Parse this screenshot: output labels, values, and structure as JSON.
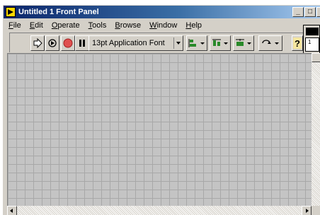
{
  "window": {
    "title": "Untitled 1 Front Panel",
    "controls": {
      "minimize": "_",
      "maximize": "□",
      "close": "×"
    }
  },
  "menubar": {
    "items": [
      {
        "mnemonic": "F",
        "rest": "ile"
      },
      {
        "mnemonic": "E",
        "rest": "dit"
      },
      {
        "mnemonic": "O",
        "rest": "perate"
      },
      {
        "mnemonic": "T",
        "rest": "ools"
      },
      {
        "mnemonic": "B",
        "rest": "rowse"
      },
      {
        "mnemonic": "W",
        "rest": "indow"
      },
      {
        "mnemonic": "H",
        "rest": "elp"
      }
    ]
  },
  "toolbar": {
    "buttons": [
      "run-arrow-icon",
      "run-continuously-icon",
      "abort-execution-icon",
      "pause-icon"
    ],
    "font_select": {
      "value": "13pt Application Font"
    },
    "dropdowns": [
      "align-objects-icon",
      "distribute-objects-icon",
      "resize-objects-icon",
      "reorder-icon"
    ],
    "help": "context-help-icon"
  },
  "connector": {
    "number": "1"
  },
  "colors": {
    "title_active": "#0a246a",
    "title_gradient_end": "#a6caf0",
    "panel_bg": "#c4c4c4",
    "grid_line": "#a8a8a8",
    "chrome": "#d4d0c8",
    "abort_red": "#e05050",
    "help_yellow": "#f6e6a0"
  }
}
